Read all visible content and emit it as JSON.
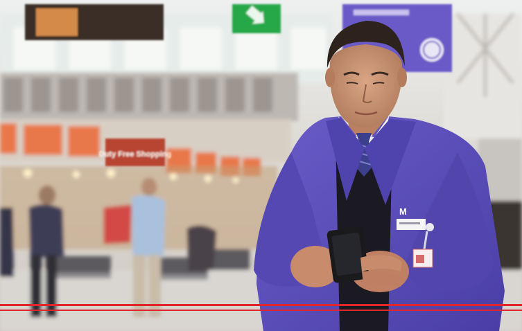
{
  "photo": {
    "shop_sign_text": "Duty Free Shopping",
    "badge_letter": "M"
  },
  "colors": {
    "jacket": "#5c4fb8",
    "jacket_shadow": "#3f3690",
    "sign_purple": "#6a5ac8",
    "exit_green": "#27a84a",
    "accent_stripe": "#e0262a",
    "shop_orange": "#e8784a",
    "floor": "#d9d6d2"
  }
}
